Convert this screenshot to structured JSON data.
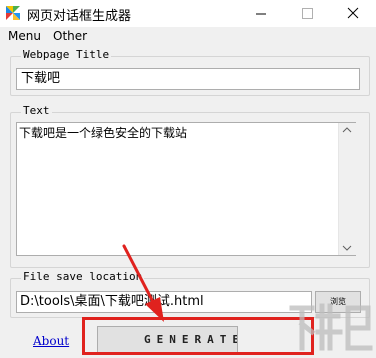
{
  "window": {
    "title": "网页对话框生成器"
  },
  "menu": {
    "items": [
      "Menu",
      "Other"
    ]
  },
  "title_group": {
    "legend": "Webpage Title",
    "value": "下载吧"
  },
  "text_group": {
    "legend": "Text",
    "value": "下载吧是一个绿色安全的下载站"
  },
  "file_group": {
    "legend": "File save location",
    "value": "D:\\tools\\桌面\\下载吧测试.html",
    "browse_label": "浏览"
  },
  "footer": {
    "about_label": "About",
    "generate_label": "GENERATE"
  },
  "annotation": {
    "color": "#e0221e"
  },
  "icons": [
    "app-icon",
    "minimize-icon",
    "maximize-icon",
    "close-icon",
    "scroll-up-icon",
    "scroll-down-icon",
    "arrow-annotation",
    "watermark-logo"
  ]
}
